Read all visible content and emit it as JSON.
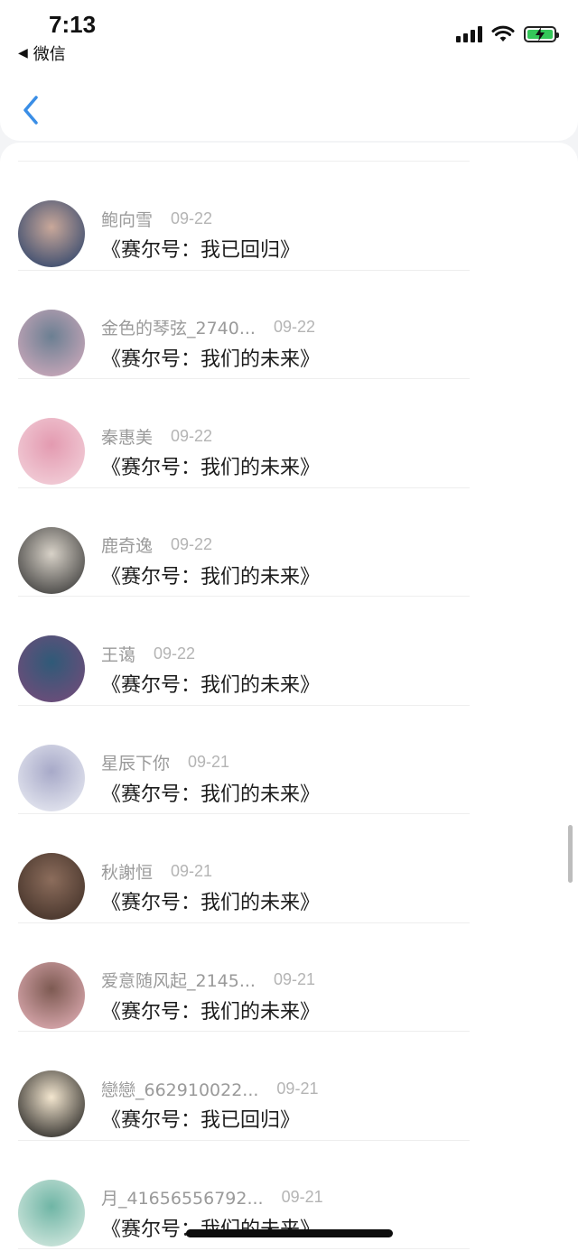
{
  "status_bar": {
    "time": "7:13",
    "back_app_label": "微信",
    "icons": [
      "cellular-signal-icon",
      "wifi-icon",
      "battery-charging-icon"
    ]
  },
  "nav": {
    "back_icon": "chevron-left-icon",
    "accent_color": "#3a8ee6"
  },
  "list": {
    "items": [
      {
        "name": "鲍向雪",
        "date": "09-22",
        "title": "《赛尔号：我已回归》",
        "avatar_colors": [
          "#1f3a66",
          "#c9a89a"
        ]
      },
      {
        "name": "金色的琴弦_2740...",
        "date": "09-22",
        "title": "《赛尔号：我们的未来》",
        "avatar_colors": [
          "#d9aec0",
          "#6b7f92"
        ]
      },
      {
        "name": "秦惠美",
        "date": "09-22",
        "title": "《赛尔号：我们的未来》",
        "avatar_colors": [
          "#f4d6de",
          "#e39ab0"
        ]
      },
      {
        "name": "鹿奇逸",
        "date": "09-22",
        "title": "《赛尔号：我们的未来》",
        "avatar_colors": [
          "#2b2b2b",
          "#d8d2c8"
        ]
      },
      {
        "name": "王蔼",
        "date": "09-22",
        "title": "《赛尔号：我们的未来》",
        "avatar_colors": [
          "#7a4a7a",
          "#2f5a78"
        ]
      },
      {
        "name": "星辰下你",
        "date": "09-21",
        "title": "《赛尔号：我们的未来》",
        "avatar_colors": [
          "#eef0f6",
          "#a7a9c8"
        ]
      },
      {
        "name": "秋謝恒",
        "date": "09-21",
        "title": "《赛尔号：我们的未来》",
        "avatar_colors": [
          "#3a2a22",
          "#8c6d5c"
        ]
      },
      {
        "name": "爱意随风起_2145...",
        "date": "09-21",
        "title": "《赛尔号：我们的未来》",
        "avatar_colors": [
          "#e9b5bd",
          "#7d5a52"
        ]
      },
      {
        "name": "戀戀_662910022...",
        "date": "09-21",
        "title": "《赛尔号：我已回归》",
        "avatar_colors": [
          "#111111",
          "#f3e6cf"
        ]
      },
      {
        "name": "月_41656556792...",
        "date": "09-21",
        "title": "《赛尔号：我们的未来》",
        "avatar_colors": [
          "#dfeee6",
          "#6fb5a5"
        ]
      }
    ]
  }
}
